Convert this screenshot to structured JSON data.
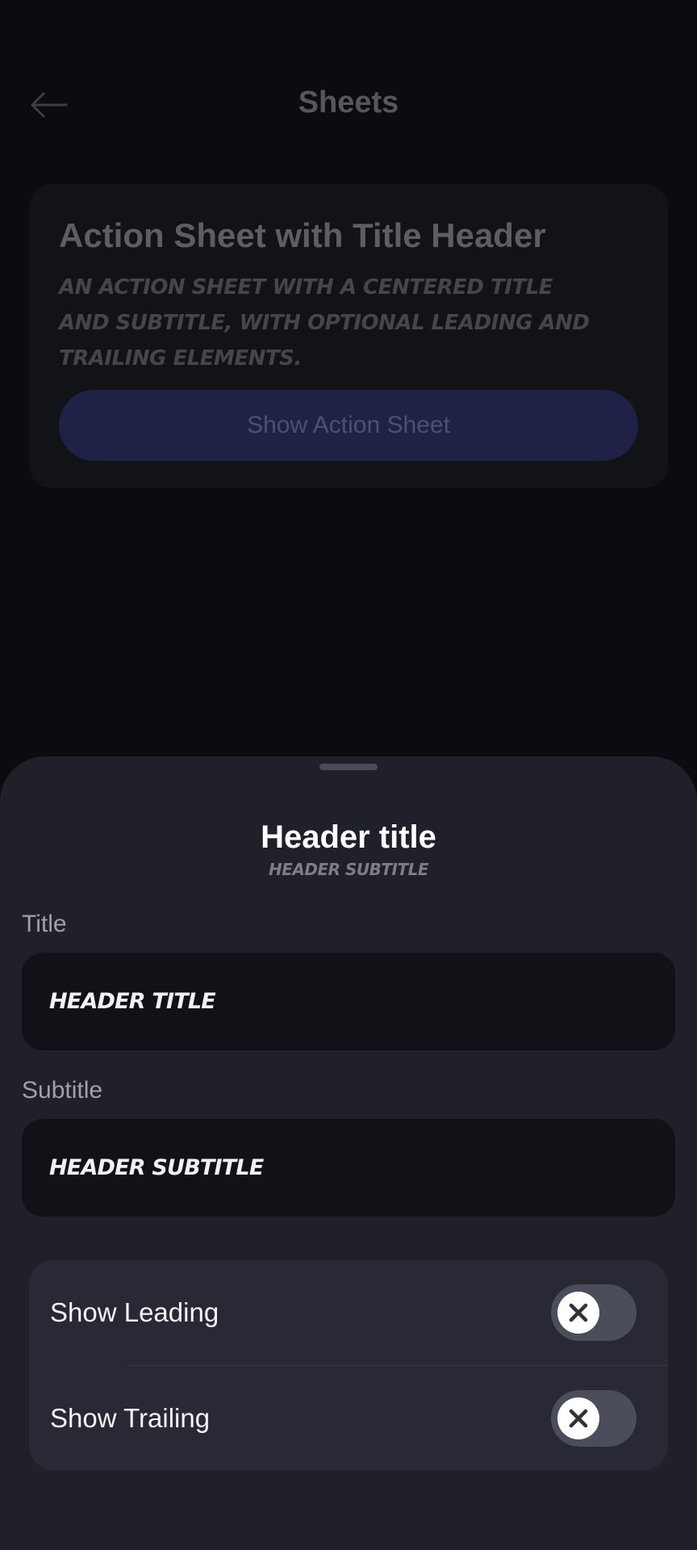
{
  "header": {
    "title": "Sheets",
    "back_icon": "arrow-left-icon"
  },
  "demo_card": {
    "title": "Action Sheet with Title Header",
    "description": "An action sheet with a centered title and subtitle, with optional leading and trailing elements.",
    "button_label": "Show Action Sheet"
  },
  "sheet": {
    "title": "Header title",
    "subtitle": "Header subtitle",
    "fields": {
      "title_label": "Title",
      "title_value": "Header title",
      "subtitle_label": "Subtitle",
      "subtitle_value": "Header subtitle"
    },
    "toggles": [
      {
        "label": "Show Leading",
        "state": "off",
        "icon": "close-icon"
      },
      {
        "label": "Show Trailing",
        "state": "off",
        "icon": "close-icon"
      }
    ]
  },
  "colors": {
    "sheet_background": "#1f2029",
    "accent_button": "#1f2147",
    "page_background": "#0b0c0f"
  }
}
